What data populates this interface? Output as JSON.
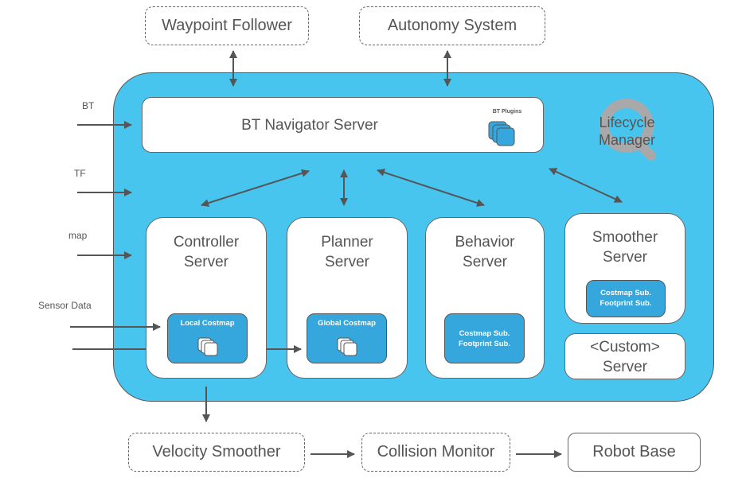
{
  "external_top": {
    "waypoint_follower": "Waypoint Follower",
    "autonomy_system": "Autonomy System"
  },
  "inputs": {
    "bt": "BT",
    "tf": "TF",
    "map": "map",
    "sensor_data": "Sensor Data"
  },
  "bt_navigator": {
    "title": "BT Navigator Server",
    "plugins_label": "BT Plugins"
  },
  "lifecycle_manager": {
    "line1": "Lifecycle",
    "line2": "Manager"
  },
  "servers": {
    "controller": {
      "line1": "Controller",
      "line2": "Server",
      "sub_title": "Local Costmap"
    },
    "planner": {
      "line1": "Planner",
      "line2": "Server",
      "sub_title": "Global Costmap"
    },
    "behavior": {
      "line1": "Behavior",
      "line2": "Server",
      "sub_line1": "Costmap Sub.",
      "sub_line2": "Footprint Sub."
    },
    "smoother": {
      "line1": "Smoother",
      "line2": "Server",
      "sub_line1": "Costmap Sub.",
      "sub_line2": "Footprint Sub."
    },
    "custom": {
      "line1": "<Custom>",
      "line2": "Server"
    }
  },
  "external_bottom": {
    "velocity_smoother": "Velocity Smoother",
    "collision_monitor": "Collision Monitor",
    "robot_base": "Robot Base"
  },
  "colors": {
    "container_fill": "#48c5ef",
    "sub_fill": "#36a7dc",
    "arrow": "#555555",
    "text": "#555555"
  }
}
